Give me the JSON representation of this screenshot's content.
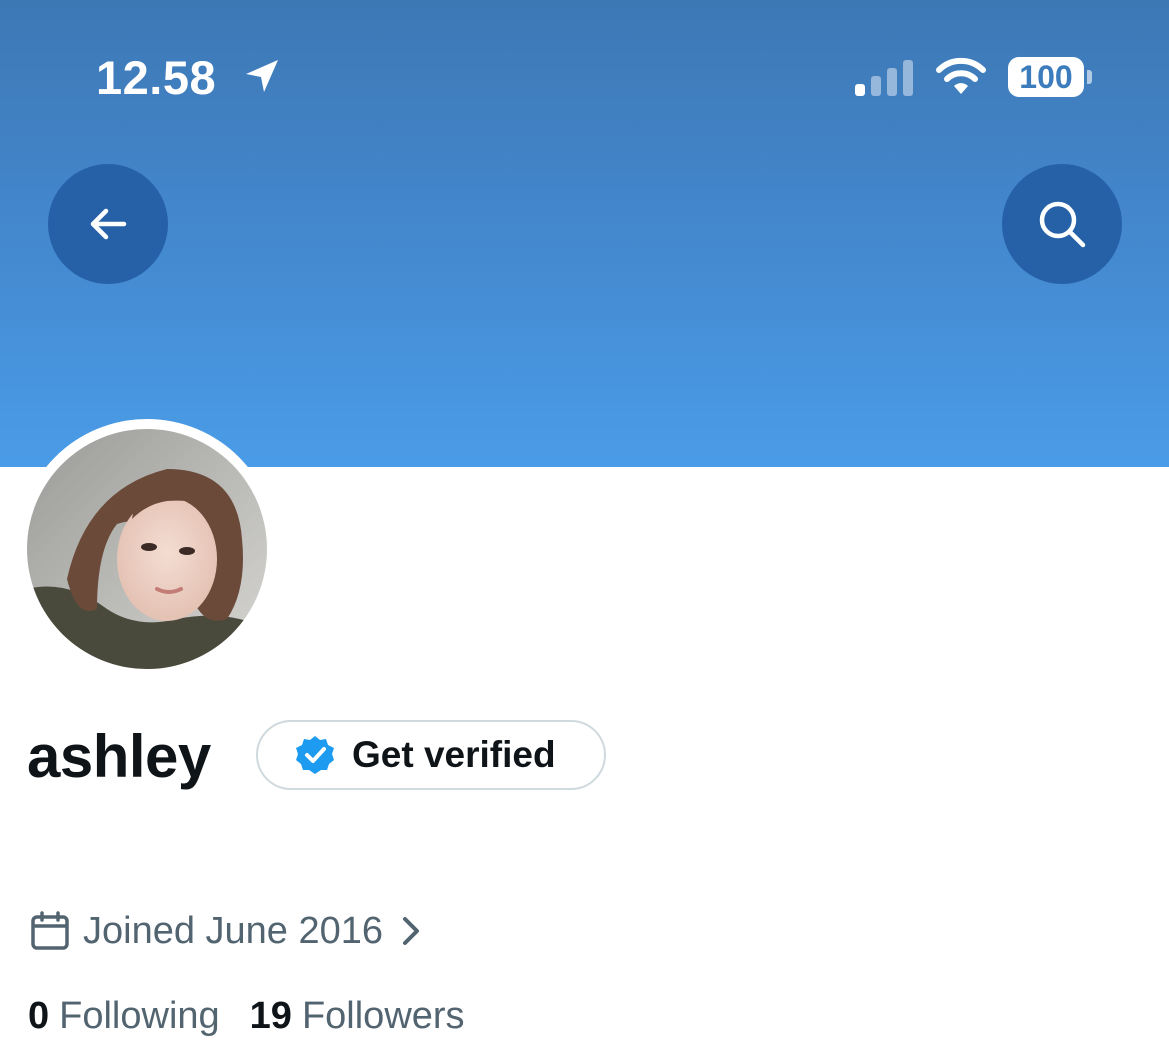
{
  "status_bar": {
    "time": "12.58",
    "battery_level": "100",
    "icons": [
      "location-arrow-icon",
      "cellular-signal-icon",
      "wifi-icon",
      "battery-icon"
    ]
  },
  "header": {
    "banner_color_top": "#3d78b5",
    "banner_color_bottom": "#4a9ce8",
    "back_icon": "arrow-left-icon",
    "search_icon": "search-icon"
  },
  "profile": {
    "display_name": "ashley",
    "verify_label": "Get verified",
    "verify_badge_color": "#1d9bf0",
    "joined": "Joined June 2016",
    "following_count": "0",
    "following_label": "Following",
    "followers_count": "19",
    "followers_label": "Followers"
  }
}
